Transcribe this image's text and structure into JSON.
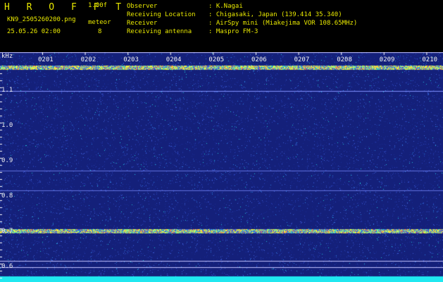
{
  "header": {
    "title": "H R O F F T",
    "version": "1.00f",
    "filename": "KN9_2505260200.png",
    "meteor_label": "meteor",
    "meteor_count": "8",
    "datetime": "25.05.26 02:00"
  },
  "info": {
    "observer_label": "Observer",
    "observer_value": ": K.Nagai",
    "location_label": "Receiving Location",
    "location_value": ": Chigasaki, Japan (139.414 35.340)",
    "receiver_label": "Receiver",
    "receiver_value": ": AirSpy mini (Miakejima VOR 108.65MHz)",
    "antenna_label": "Receiving antenna",
    "antenna_value": ": Maspro FM-3"
  },
  "plot": {
    "unit": "kHz",
    "time_ticks": [
      "0201",
      "0202",
      "0203",
      "0204",
      "0205",
      "0206",
      "0207",
      "0208",
      "0209",
      "0210"
    ],
    "freq_ticks": [
      "1.1",
      "1.0",
      "0.9",
      "0.8",
      "0.7",
      "0.6"
    ],
    "colors": {
      "background": "#1a2a8a",
      "signal": "#e8ff40",
      "text": "#f0f0f0",
      "accent": "#e8e800"
    }
  }
}
